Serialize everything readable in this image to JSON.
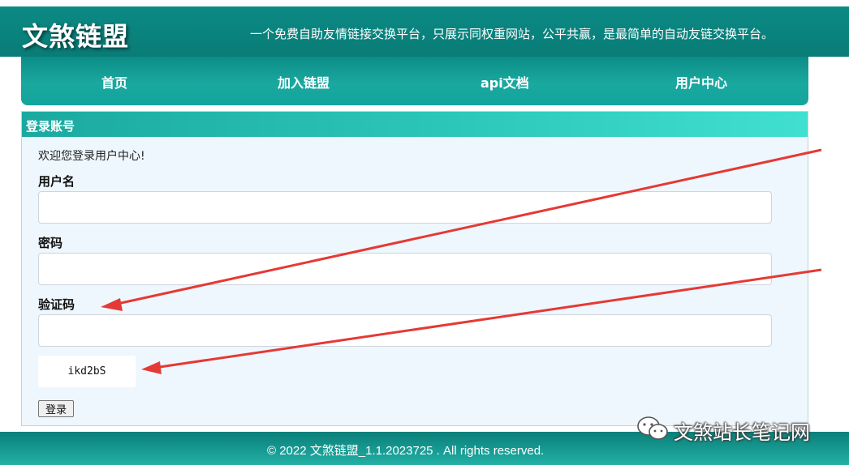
{
  "header": {
    "site_title": "文煞链盟",
    "slogan": "一个免费自助友情链接交换平台，只展示同权重网站，公平共赢，是最简单的自动友链交换平台。"
  },
  "nav": {
    "items": [
      {
        "label": "首页"
      },
      {
        "label": "加入链盟"
      },
      {
        "label": "api文档"
      },
      {
        "label": "用户中心"
      }
    ]
  },
  "login_panel": {
    "title": "登录账号",
    "welcome": "欢迎您登录用户中心!",
    "username": {
      "label": "用户名",
      "value": "",
      "placeholder": ""
    },
    "password": {
      "label": "密码",
      "value": "",
      "placeholder": ""
    },
    "captcha_field": {
      "label": "验证码",
      "value": "",
      "placeholder": ""
    },
    "captcha_image_text": "ikd2bS",
    "submit_label": "登录"
  },
  "footer": {
    "text": "© 2022 文煞链盟_1.1.2023725 . All rights reserved."
  },
  "watermark": {
    "text": "文煞站长笔记网",
    "icon": "wechat-icon"
  },
  "colors": {
    "header_bg": "#0a7c77",
    "nav_bg": "#1aa89f",
    "panel_head_start": "#1ba99f",
    "panel_head_end": "#40e0d0",
    "panel_bg": "#eef7fd",
    "annotation_arrow": "#e53935"
  }
}
